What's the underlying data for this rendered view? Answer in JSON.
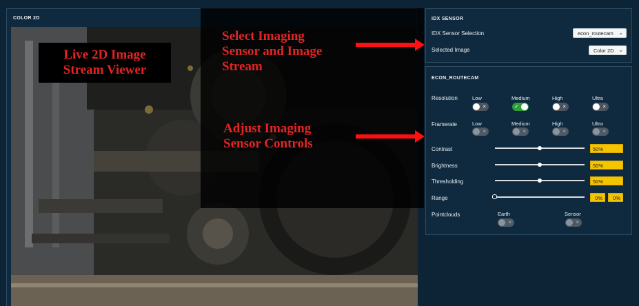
{
  "viewer": {
    "title": "COLOR 2D"
  },
  "callouts": {
    "viewer": [
      "Live 2D Image",
      "Stream Viewer"
    ],
    "sensor": [
      "Select Imaging",
      "Sensor and Image",
      "Stream"
    ],
    "controls": [
      "Adjust Imaging",
      "Sensor Controls"
    ]
  },
  "idx_sensor": {
    "title": "IDX SENSOR",
    "sensor_label": "IDX Sensor Selection",
    "sensor_value": "econ_routecam",
    "image_label": "Selected Image",
    "image_value": "Color 2D"
  },
  "camera": {
    "title": "ECON_ROUTECAM",
    "resolution": {
      "label": "Resolution",
      "options": [
        {
          "label": "Low",
          "state": "off"
        },
        {
          "label": "Medium",
          "state": "on"
        },
        {
          "label": "High",
          "state": "off"
        },
        {
          "label": "Ultra",
          "state": "off"
        }
      ]
    },
    "framerate": {
      "label": "Framerate",
      "options": [
        {
          "label": "Low",
          "state": "disabled"
        },
        {
          "label": "Medium",
          "state": "disabled"
        },
        {
          "label": "High",
          "state": "disabled"
        },
        {
          "label": "Ultra",
          "state": "disabled"
        }
      ]
    },
    "contrast": {
      "label": "Contrast",
      "value": 50,
      "display": "50%"
    },
    "brightness": {
      "label": "Brightness",
      "value": 50,
      "display": "50%"
    },
    "thresholding": {
      "label": "Thresholding",
      "value": 50,
      "display": "50%"
    },
    "range": {
      "label": "Range",
      "value": 0,
      "min_display": "0%",
      "max_display": "0%"
    },
    "pointclouds": {
      "label": "Pointclouds",
      "options": [
        {
          "label": "Earth",
          "state": "disabled"
        },
        {
          "label": "Sensor",
          "state": "disabled"
        }
      ]
    }
  },
  "icons": {
    "check": "✓",
    "cross": "×",
    "chevron": "⌄"
  },
  "colors": {
    "accent": "#f5c400",
    "callout": "#e32424",
    "arrow": "#ff1010",
    "toggle_on": "#2e9e3a"
  }
}
